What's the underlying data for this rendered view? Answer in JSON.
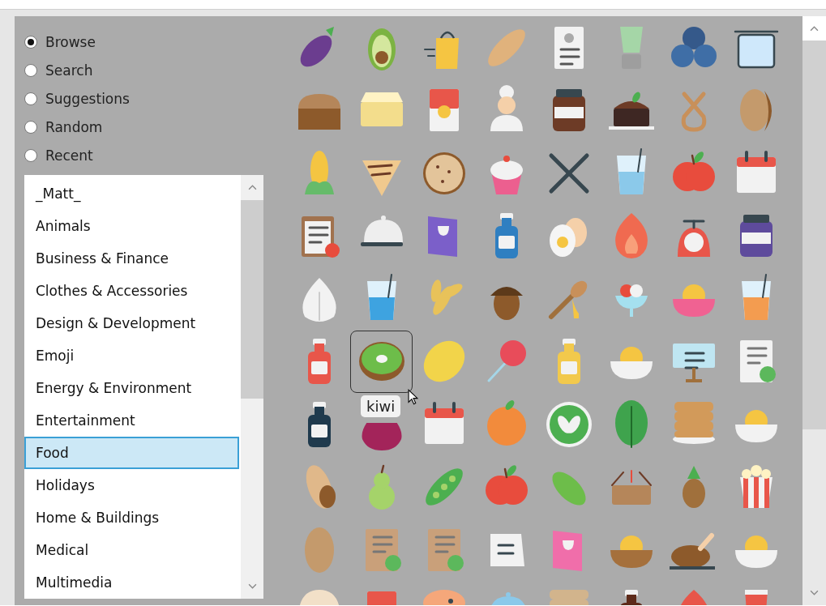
{
  "modes": [
    {
      "label": "Browse",
      "selected": true
    },
    {
      "label": "Search",
      "selected": false
    },
    {
      "label": "Suggestions",
      "selected": false
    },
    {
      "label": "Random",
      "selected": false
    },
    {
      "label": "Recent",
      "selected": false
    }
  ],
  "categories": [
    {
      "label": "_Matt_",
      "selected": false
    },
    {
      "label": "Animals",
      "selected": false
    },
    {
      "label": "Business & Finance",
      "selected": false
    },
    {
      "label": "Clothes & Accessories",
      "selected": false
    },
    {
      "label": "Design & Development",
      "selected": false
    },
    {
      "label": "Emoji",
      "selected": false
    },
    {
      "label": "Energy & Environment",
      "selected": false
    },
    {
      "label": "Entertainment",
      "selected": false
    },
    {
      "label": "Food",
      "selected": true
    },
    {
      "label": "Holidays",
      "selected": false
    },
    {
      "label": "Home & Buildings",
      "selected": false
    },
    {
      "label": "Medical",
      "selected": false
    },
    {
      "label": "Multimedia",
      "selected": false
    }
  ],
  "icon_grid": {
    "tooltip": "kiwi",
    "cells": [
      {
        "kind": "eggplant",
        "color": "#6b3d8f",
        "selected": false
      },
      {
        "kind": "avocado",
        "color": "#7cb342",
        "selected": false
      },
      {
        "kind": "bag",
        "color": "#f5c542",
        "selected": false
      },
      {
        "kind": "baguette",
        "color": "#e0b27c",
        "selected": false
      },
      {
        "kind": "receipt",
        "color": "#f2f2f2",
        "selected": false
      },
      {
        "kind": "blender",
        "color": "#a5d6a7",
        "selected": false
      },
      {
        "kind": "berries",
        "color": "#3f6ea6",
        "selected": false
      },
      {
        "kind": "pot",
        "color": "#cfe8fb",
        "selected": false
      },
      {
        "kind": "loaf",
        "color": "#b5865a",
        "selected": false
      },
      {
        "kind": "butter",
        "color": "#f3dd8c",
        "selected": false
      },
      {
        "kind": "can",
        "color": "#e8564a",
        "selected": false
      },
      {
        "kind": "chef",
        "color": "#f2f2f2",
        "selected": false
      },
      {
        "kind": "jar",
        "color": "#6d3b26",
        "selected": false
      },
      {
        "kind": "cake",
        "color": "#3e2723",
        "selected": false
      },
      {
        "kind": "pretzel",
        "color": "#c8905a",
        "selected": false
      },
      {
        "kind": "bean",
        "color": "#c49a6c",
        "selected": false
      },
      {
        "kind": "corn",
        "color": "#f4c542",
        "selected": false
      },
      {
        "kind": "crepe",
        "color": "#f0c98e",
        "selected": false
      },
      {
        "kind": "cookie",
        "color": "#e3c49a",
        "selected": false
      },
      {
        "kind": "cupcake",
        "color": "#ec5f8f",
        "selected": false
      },
      {
        "kind": "cutlery",
        "color": "#37474f",
        "selected": false
      },
      {
        "kind": "glass",
        "color": "#8bc9ea",
        "selected": false
      },
      {
        "kind": "apple",
        "color": "#e84c3d",
        "selected": false
      },
      {
        "kind": "calendar",
        "color": "#f2f2f2",
        "selected": false
      },
      {
        "kind": "clipboard",
        "color": "#a1724e",
        "selected": false
      },
      {
        "kind": "cloche",
        "color": "#eeeeee",
        "selected": false
      },
      {
        "kind": "menu",
        "color": "#7b5fc9",
        "selected": false
      },
      {
        "kind": "bottle",
        "color": "#2f7fc1",
        "selected": false
      },
      {
        "kind": "eggs",
        "color": "#f5f5f5",
        "selected": false
      },
      {
        "kind": "flame",
        "color": "#f06a50",
        "selected": false
      },
      {
        "kind": "scale",
        "color": "#f2f2f2",
        "selected": false
      },
      {
        "kind": "jar",
        "color": "#5e4b9c",
        "selected": false
      },
      {
        "kind": "garlic",
        "color": "#f2f2f2",
        "selected": false
      },
      {
        "kind": "glass",
        "color": "#3ea3e0",
        "selected": false
      },
      {
        "kind": "wheat",
        "color": "#e8c25a",
        "selected": false
      },
      {
        "kind": "acorn",
        "color": "#8d5a2b",
        "selected": false
      },
      {
        "kind": "dipper",
        "color": "#a0703c",
        "selected": false
      },
      {
        "kind": "sundae",
        "color": "#f2f2f2",
        "selected": false
      },
      {
        "kind": "bowl",
        "color": "#f06292",
        "selected": false
      },
      {
        "kind": "glass",
        "color": "#f39c50",
        "selected": false
      },
      {
        "kind": "bottle",
        "color": "#e8564a",
        "selected": false
      },
      {
        "kind": "kiwi",
        "color": "#6dbd4a",
        "selected": true
      },
      {
        "kind": "lemon",
        "color": "#f2d44a",
        "selected": false
      },
      {
        "kind": "lollipop",
        "color": "#e84c5a",
        "selected": false
      },
      {
        "kind": "bottle",
        "color": "#f2c94c",
        "selected": false
      },
      {
        "kind": "bowl",
        "color": "#f2f2f2",
        "selected": false
      },
      {
        "kind": "screen",
        "color": "#bfe6f2",
        "selected": false
      },
      {
        "kind": "recipe",
        "color": "#f2f2f2",
        "selected": false
      },
      {
        "kind": "bottle",
        "color": "#1f3a4d",
        "selected": false
      },
      {
        "kind": "onion",
        "color": "#a3245a",
        "selected": false
      },
      {
        "kind": "calendar",
        "color": "#f2f2f2",
        "selected": false
      },
      {
        "kind": "tangerine",
        "color": "#f28b3c",
        "selected": false
      },
      {
        "kind": "badge",
        "color": "#4caf50",
        "selected": false
      },
      {
        "kind": "leaf",
        "color": "#3fa34d",
        "selected": false
      },
      {
        "kind": "pancakes",
        "color": "#d29a5a",
        "selected": false
      },
      {
        "kind": "bowl",
        "color": "#f2f2f2",
        "selected": false
      },
      {
        "kind": "peanut",
        "color": "#e0b88a",
        "selected": false
      },
      {
        "kind": "pear",
        "color": "#a5d36a",
        "selected": false
      },
      {
        "kind": "peapod",
        "color": "#4caf50",
        "selected": false
      },
      {
        "kind": "apple",
        "color": "#e84c3d",
        "selected": false
      },
      {
        "kind": "pickle",
        "color": "#6dbd4a",
        "selected": false
      },
      {
        "kind": "basket",
        "color": "#b5865a",
        "selected": false
      },
      {
        "kind": "pineapple",
        "color": "#a0703c",
        "selected": false
      },
      {
        "kind": "popcorn",
        "color": "#e8564a",
        "selected": false
      },
      {
        "kind": "potato",
        "color": "#c49a6c",
        "selected": false
      },
      {
        "kind": "recipe",
        "color": "#c9a07a",
        "selected": false
      },
      {
        "kind": "recipe",
        "color": "#c9a07a",
        "selected": false
      },
      {
        "kind": "sign",
        "color": "#f2f2f2",
        "selected": false
      },
      {
        "kind": "menu",
        "color": "#f06eaa",
        "selected": false
      },
      {
        "kind": "bowl",
        "color": "#a5703c",
        "selected": false
      },
      {
        "kind": "chicken",
        "color": "#8d5a2b",
        "selected": false
      },
      {
        "kind": "bowl",
        "color": "#f2f2f2",
        "selected": false
      },
      {
        "kind": "dumpling",
        "color": "#f2e0c8",
        "selected": false
      },
      {
        "kind": "can",
        "color": "#e8564a",
        "selected": false
      },
      {
        "kind": "shrimp",
        "color": "#f5a77a",
        "selected": false
      },
      {
        "kind": "cloche",
        "color": "#8bc9ea",
        "selected": false
      },
      {
        "kind": "pancakes",
        "color": "#d2b48c",
        "selected": false
      },
      {
        "kind": "bottle",
        "color": "#5d2a1a",
        "selected": false
      },
      {
        "kind": "flame",
        "color": "#e8564a",
        "selected": false
      },
      {
        "kind": "tumbler",
        "color": "#e8564a",
        "selected": false
      }
    ]
  }
}
